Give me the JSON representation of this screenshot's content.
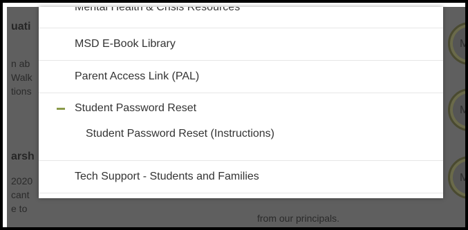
{
  "background": {
    "left_fragments": [
      "uati",
      "n ab",
      "Walk",
      "tions",
      "arsh",
      "2020",
      "cant",
      "e to"
    ],
    "bottom_fragment": "from our principals.",
    "circle_glyphs": [
      "M",
      "M",
      "M"
    ]
  },
  "menu": {
    "items": [
      {
        "label": "Mental Health & Crisis Resources"
      },
      {
        "label": "MSD E-Book Library"
      },
      {
        "label": "Parent Access Link (PAL)"
      },
      {
        "label": "Student Password Reset",
        "expanded": true,
        "subitems": [
          {
            "label": "Student Password Reset (Instructions)"
          }
        ]
      },
      {
        "label": "Tech Support - Students and Families"
      }
    ],
    "accent_color": "#8a9a4a"
  }
}
